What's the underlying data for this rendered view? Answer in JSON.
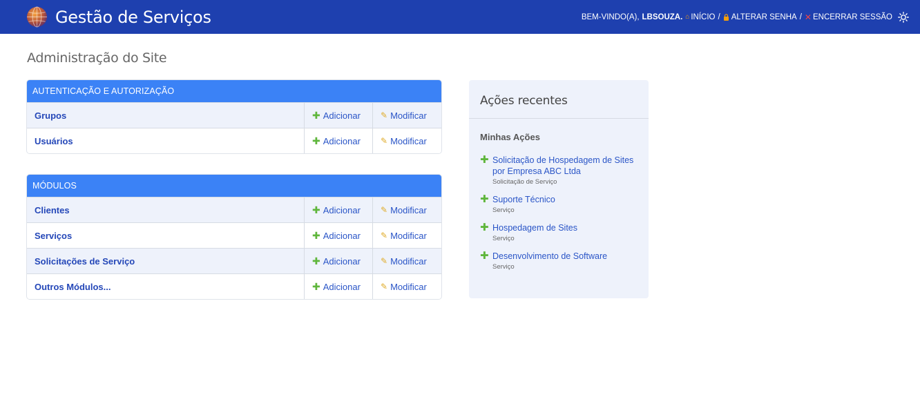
{
  "header": {
    "title": "Gestão de Serviços",
    "welcome": "BEM-VINDO(A),",
    "username": "LBSOUZA.",
    "links": {
      "home": "INÍCIO",
      "change_password": "ALTERAR SENHA",
      "logout": "ENCERRAR SESSÃO"
    },
    "separator": "/"
  },
  "page": {
    "title": "Administração do Site"
  },
  "modules": [
    {
      "title": "AUTENTICAÇÃO E AUTORIZAÇÃO",
      "rows": [
        {
          "name": "Grupos",
          "add": "Adicionar",
          "change": "Modificar"
        },
        {
          "name": "Usuários",
          "add": "Adicionar",
          "change": "Modificar"
        }
      ]
    },
    {
      "title": "MÓDULOS",
      "rows": [
        {
          "name": "Clientes",
          "add": "Adicionar",
          "change": "Modificar"
        },
        {
          "name": "Serviços",
          "add": "Adicionar",
          "change": "Modificar"
        },
        {
          "name": "Solicitações de Serviço",
          "add": "Adicionar",
          "change": "Modificar"
        },
        {
          "name": "Outros Módulos...",
          "add": "Adicionar",
          "change": "Modificar"
        }
      ]
    }
  ],
  "recent_actions": {
    "title": "Ações recentes",
    "subtitle": "Minhas Ações",
    "items": [
      {
        "label": "Solicitação de Hospedagem de Sites por Empresa ABC Ltda",
        "type": "Solicitação de Serviço"
      },
      {
        "label": "Suporte Técnico",
        "type": "Serviço"
      },
      {
        "label": "Hospedagem de Sites",
        "type": "Serviço"
      },
      {
        "label": "Desenvolvimento de Software",
        "type": "Serviço"
      }
    ]
  },
  "icons": {
    "logo": "globe-logo-icon",
    "home": "home-icon",
    "lock": "lock-icon",
    "logout": "x-icon",
    "theme": "sun-icon",
    "add": "plus-icon",
    "change": "pencil-icon"
  },
  "colors": {
    "header_bg": "#1e40af",
    "module_header_bg": "#3b82f6",
    "link": "#2a55c7",
    "add_icon": "#5fb63c",
    "change_icon": "#e0ac2b",
    "row_alt": "#eef2fb"
  }
}
